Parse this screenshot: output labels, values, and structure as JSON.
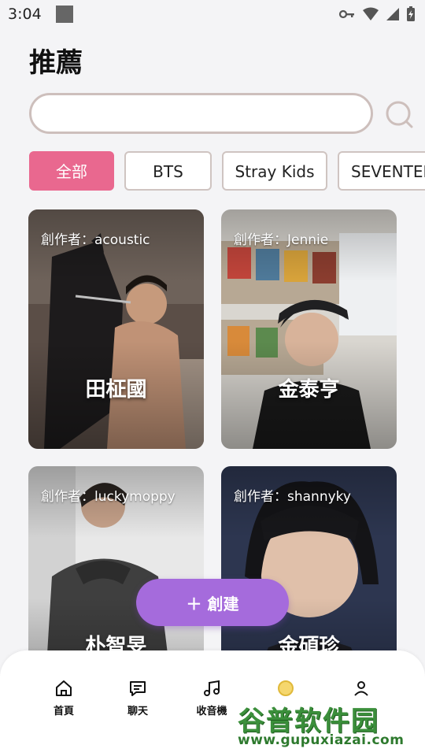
{
  "status_bar": {
    "time": "3:04"
  },
  "page": {
    "title": "推薦"
  },
  "search": {
    "placeholder": "",
    "value": ""
  },
  "filters": [
    {
      "label": "全部",
      "active": true
    },
    {
      "label": "BTS",
      "active": false
    },
    {
      "label": "Stray Kids",
      "active": false
    },
    {
      "label": "SEVENTEEN",
      "active": false
    }
  ],
  "cards": [
    {
      "author": "創作者：acoustic",
      "name": "田柾國"
    },
    {
      "author": "創作者：Jennie",
      "name": "金泰亨"
    },
    {
      "author": "創作者：luckymoppy",
      "name": "朴智旻"
    },
    {
      "author": "創作者：shannyky",
      "name": "金碩珍"
    }
  ],
  "create_button": {
    "label": "＋ 創建"
  },
  "bottom_nav": [
    {
      "label": "首頁",
      "icon": "home-icon"
    },
    {
      "label": "聊天",
      "icon": "chat-icon"
    },
    {
      "label": "收音機",
      "icon": "music-icon"
    },
    {
      "label": "",
      "icon": "coin-icon"
    },
    {
      "label": "",
      "icon": "profile-icon"
    }
  ],
  "watermark": {
    "main": "谷普软件园",
    "url": "www.gupuxiazai.com"
  },
  "colors": {
    "accent_pink": "#e9688f",
    "accent_purple": "#a56bdc",
    "watermark_green": "#3b8f3b"
  }
}
